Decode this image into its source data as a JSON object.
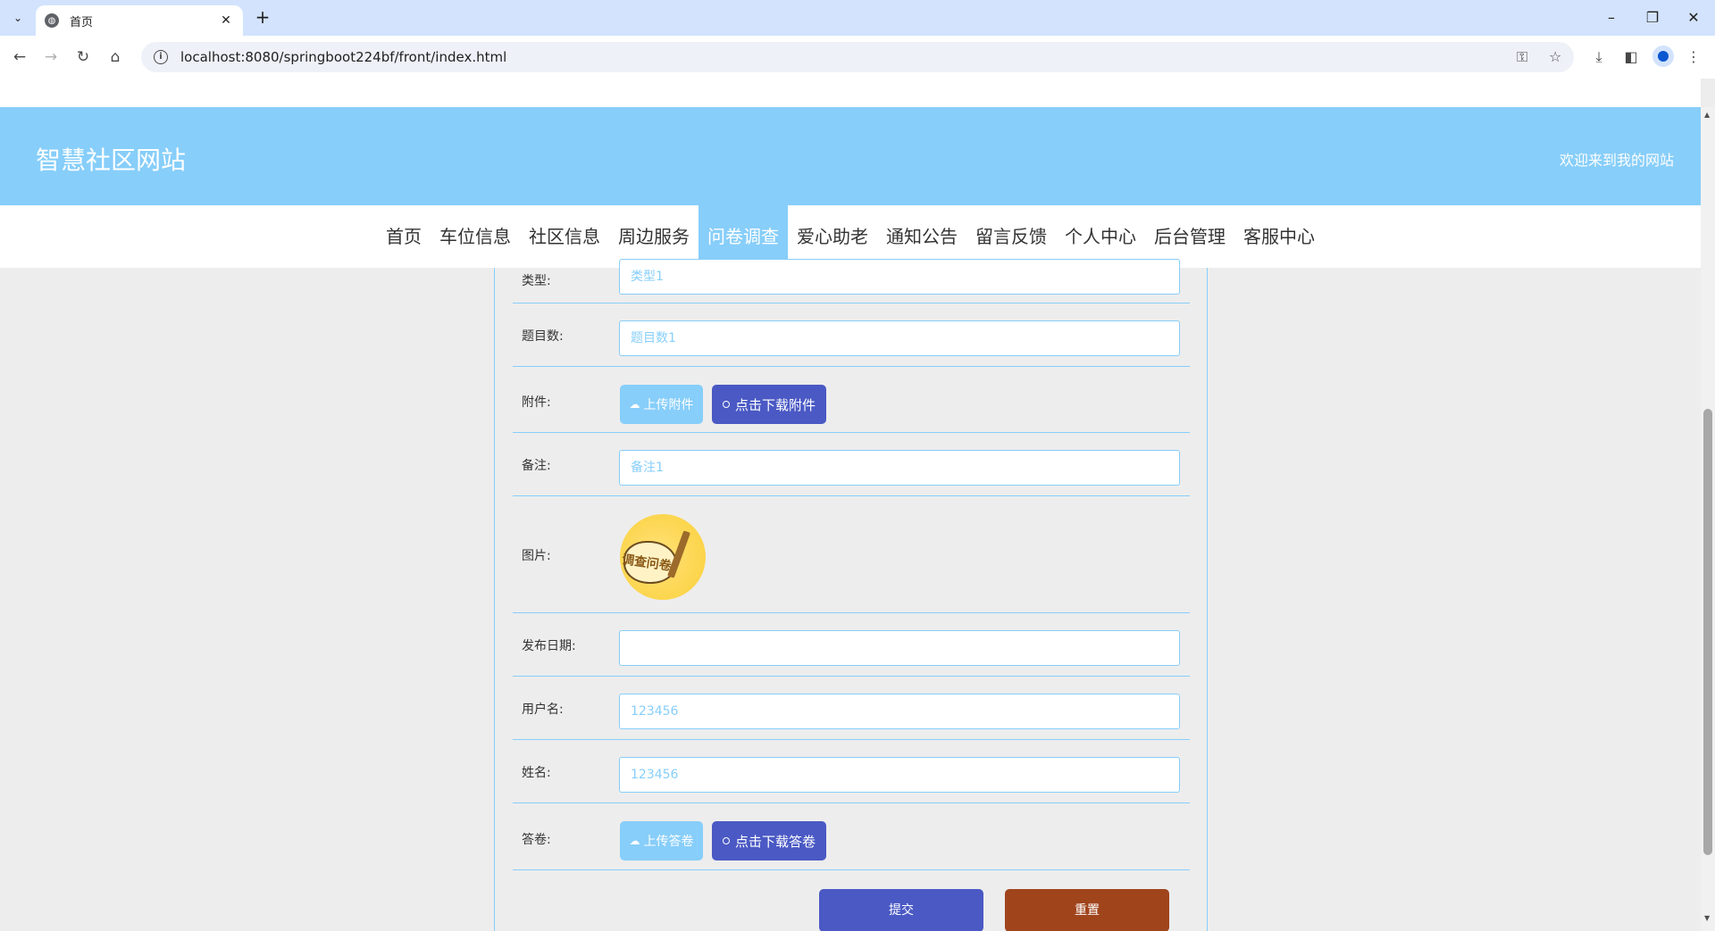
{
  "browser": {
    "tab_title": "首页",
    "url": "localhost:8080/springboot224bf/front/index.html"
  },
  "header": {
    "site_title": "智慧社区网站",
    "welcome": "欢迎来到我的网站"
  },
  "nav": {
    "items": [
      "首页",
      "车位信息",
      "社区信息",
      "周边服务",
      "问卷调查",
      "爱心助老",
      "通知公告",
      "留言反馈",
      "个人中心",
      "后台管理",
      "客服中心"
    ],
    "active": "问卷调查"
  },
  "form": {
    "type_label": "类型:",
    "type_value": "类型1",
    "count_label": "题目数:",
    "count_value": "题目数1",
    "attachment_label": "附件:",
    "upload_attachment": "上传附件",
    "download_attachment": "点击下载附件",
    "note_label": "备注:",
    "note_value": "备注1",
    "image_label": "图片:",
    "image_text": "调查问卷",
    "date_label": "发布日期:",
    "date_value": "",
    "username_label": "用户名:",
    "username_value": "123456",
    "name_label": "姓名:",
    "name_value": "123456",
    "answer_label": "答卷:",
    "upload_answer": "上传答卷",
    "download_answer": "点击下载答卷",
    "submit": "提交",
    "reset": "重置"
  },
  "colors": {
    "accent": "#87cefa",
    "primary_button": "#4a59c4",
    "reset_button": "#a0441c"
  }
}
